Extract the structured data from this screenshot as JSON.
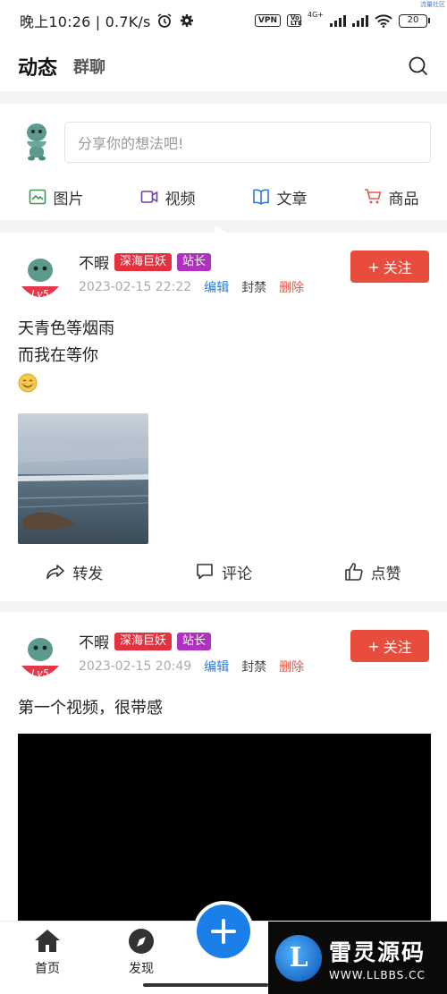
{
  "status_bar": {
    "time": "晚上10:26 | 0.7K/s",
    "vpn": "VPN",
    "volte": "Vo LTE",
    "network": "4G+",
    "battery": "20",
    "corner_tag": "流量社区"
  },
  "header": {
    "tab_active": "动态",
    "tab_other": "群聊"
  },
  "composer": {
    "placeholder": "分享你的想法吧!",
    "actions": [
      {
        "label": "图片",
        "icon": "image-icon",
        "color": "#3a9a54"
      },
      {
        "label": "视频",
        "icon": "video-icon",
        "color": "#6a3fb0"
      },
      {
        "label": "文章",
        "icon": "book-icon",
        "color": "#2f7ad6"
      },
      {
        "label": "商品",
        "icon": "cart-icon",
        "color": "#e05a4a"
      }
    ]
  },
  "posts": [
    {
      "username": "不暇",
      "level": "Lv5",
      "badges": [
        "深海巨妖",
        "站长"
      ],
      "date": "2023-02-15 22:22",
      "edit": "编辑",
      "ban": "封禁",
      "delete": "删除",
      "follow": "关注",
      "text_lines": [
        "天青色等烟雨",
        "而我在等你"
      ],
      "has_emoji": true,
      "actions": {
        "share": "转发",
        "comment": "评论",
        "like": "点赞"
      }
    },
    {
      "username": "不暇",
      "level": "Lv5",
      "badges": [
        "深海巨妖",
        "站长"
      ],
      "date": "2023-02-15 20:49",
      "edit": "编辑",
      "ban": "封禁",
      "delete": "删除",
      "follow": "关注",
      "text_lines": [
        "第一个视频，很带感"
      ]
    }
  ],
  "bottom_nav": {
    "home": "首页",
    "discover": "发现"
  },
  "watermark": {
    "title": "雷灵源码",
    "url": "WWW.LLBBS.CC",
    "logo_letter": "L"
  },
  "colors": {
    "accent_blue": "#1a7fe8",
    "follow_red": "#e74c3c",
    "badge_red": "#e6303e",
    "badge_purple": "#b030c0"
  }
}
